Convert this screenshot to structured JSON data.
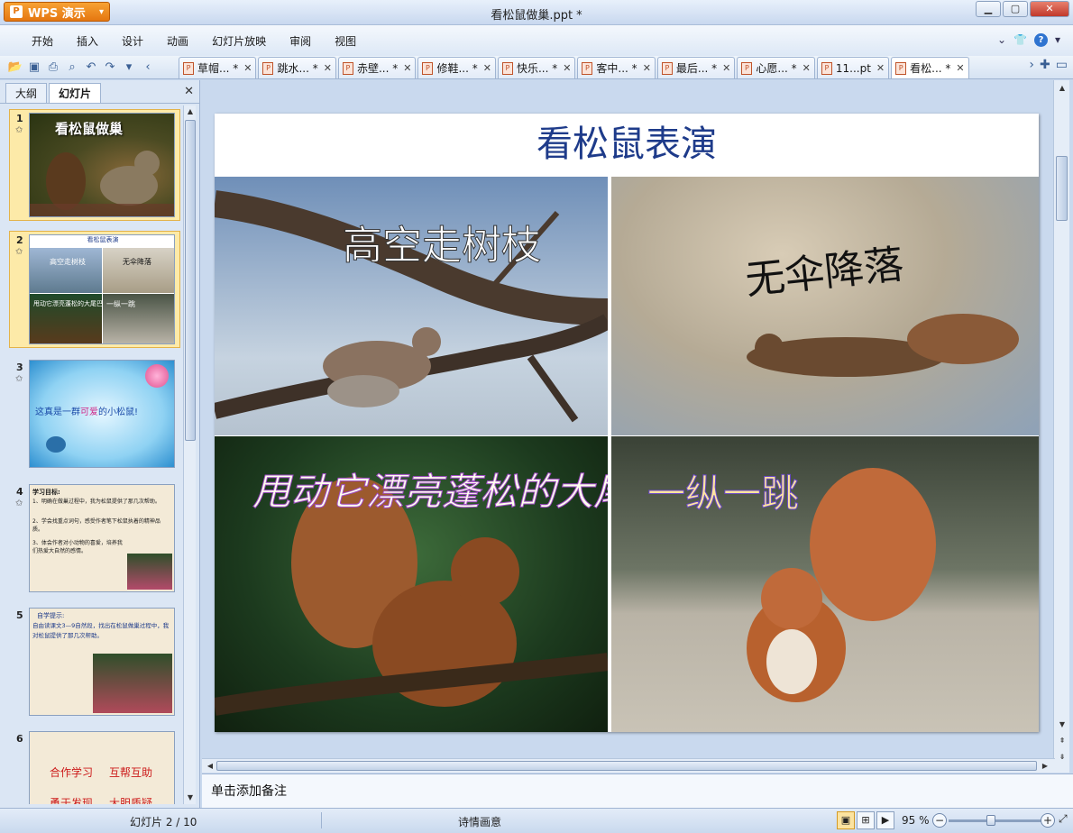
{
  "app": {
    "name": "WPS 演示",
    "document_title": "看松鼠做巢.ppt *"
  },
  "menu": [
    "开始",
    "插入",
    "设计",
    "动画",
    "幻灯片放映",
    "审阅",
    "视图"
  ],
  "tabs": [
    {
      "label": "草帽... *",
      "active": false
    },
    {
      "label": "跳水... *",
      "active": false
    },
    {
      "label": "赤壁... *",
      "active": false
    },
    {
      "label": "修鞋... *",
      "active": false
    },
    {
      "label": "快乐... *",
      "active": false
    },
    {
      "label": "客中... *",
      "active": false
    },
    {
      "label": "最后... *",
      "active": false
    },
    {
      "label": "心愿... *",
      "active": false
    },
    {
      "label": "11...pt",
      "active": false
    },
    {
      "label": "看松... *",
      "active": true
    }
  ],
  "left_panel": {
    "tab_outline": "大纲",
    "tab_slides": "幻灯片",
    "thumbnails": [
      {
        "num": "1",
        "title": "看松鼠做巢"
      },
      {
        "num": "2",
        "title": "看松鼠表演",
        "q1": "高空走树枝",
        "q2": "无伞降落",
        "q3": "甩动它漂亮蓬松的大尾巴",
        "q4": "一纵一跳"
      },
      {
        "num": "3",
        "text_a": "这真是一群",
        "text_b": "可爱",
        "text_c": "的小松鼠!"
      },
      {
        "num": "4",
        "heading": "学习目标:",
        "lines": [
          "1、明确在做巢过程中，我为松鼠提供了那几次帮助。",
          "2、学会找重点词句，感受作者笔下松鼠执着的精神品质。",
          "3、体会作者对小动物的喜爱，培养我们热爱大自然的感情。"
        ]
      },
      {
        "num": "5",
        "heading": "自学提示:",
        "body": "自由读课文3—9自然段，找出在松鼠做巢过程中，我对松鼠提供了那几次帮助。"
      },
      {
        "num": "6",
        "line1a": "合作学习",
        "line1b": "互帮互助",
        "line2a": "勇于发现",
        "line2b": "大胆质疑"
      }
    ]
  },
  "slide": {
    "title": "看松鼠表演",
    "captions": {
      "top_left": "高空走树枝",
      "top_right": "无伞降落",
      "bottom_left": "甩动它漂亮蓬松的大尾巴",
      "bottom_right": "一纵一跳"
    }
  },
  "notes": {
    "placeholder": "单击添加备注"
  },
  "status": {
    "slide_indicator": "幻灯片 2 / 10",
    "theme": "诗情画意",
    "zoom": "95 %"
  }
}
